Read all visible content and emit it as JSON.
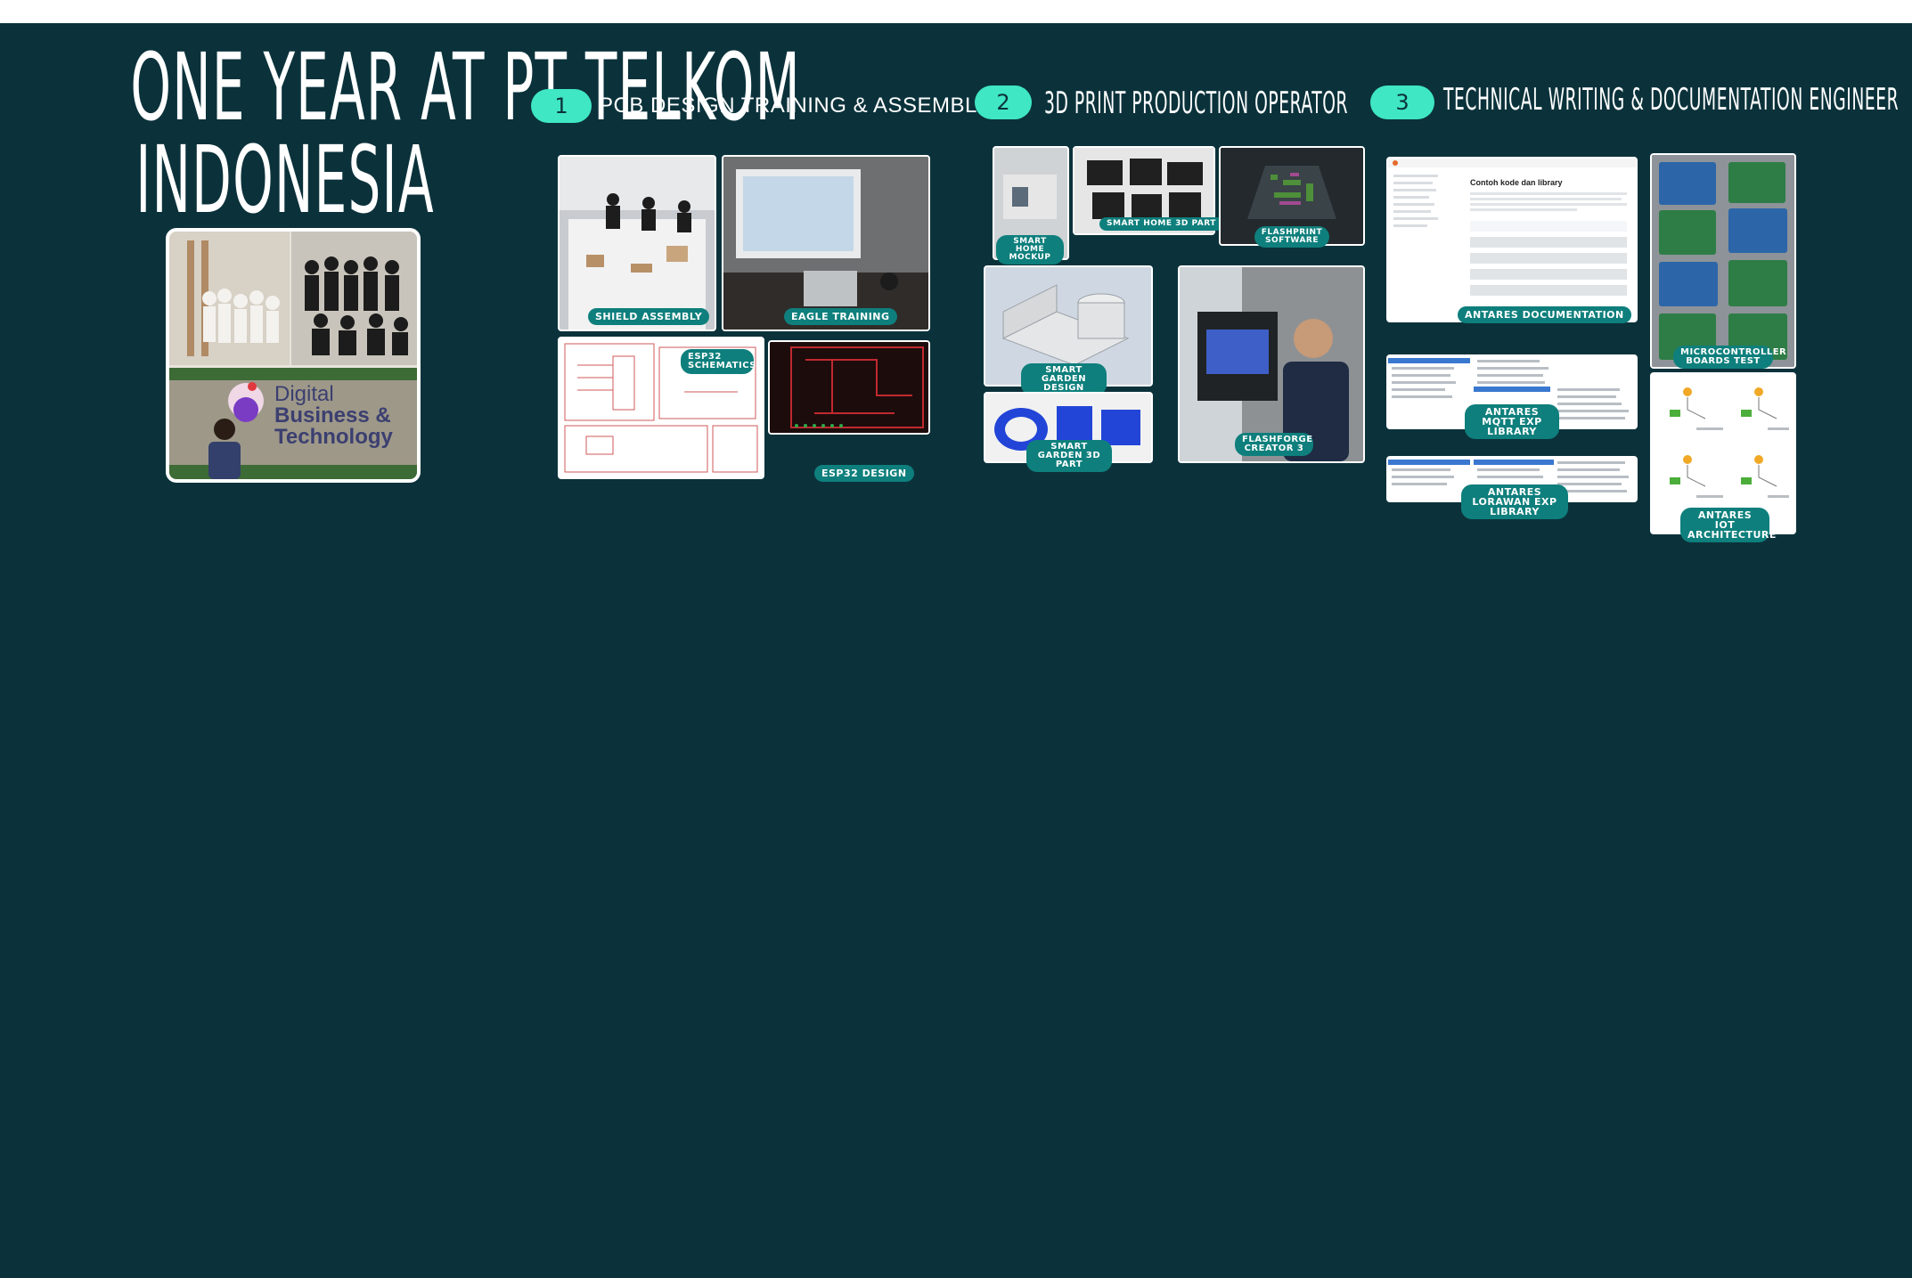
{
  "title": {
    "line1": "ONE YEAR AT PT TELKOM",
    "line2": "INDONESIA"
  },
  "intro_photo": {
    "sign_line1": "Digital",
    "sign_line2": "Business &",
    "sign_line3": "Technology"
  },
  "sections": [
    {
      "number": "1",
      "title": "PCB DESIGN TRAINING & ASSEMBLY"
    },
    {
      "number": "2",
      "title": "3D PRINT PRODUCTION OPERATOR"
    },
    {
      "number": "3",
      "title": "TECHNICAL WRITING & DOCUMENTATION ENGINEER"
    }
  ],
  "pcb": {
    "shield_assembly": "SHIELD ASSEMBLY",
    "eagle_training": "EAGLE TRAINING",
    "esp32_schematics": "ESP32 SCHEMATICS",
    "esp32_design": "ESP32 DESIGN"
  },
  "print3d": {
    "smart_home_mockup": "SMART HOME MOCKUP",
    "smart_home_3d_part": "SMART HOME 3D PART",
    "flashprint_software": "FLASHPRINT SOFTWARE",
    "smart_garden_design": "SMART GARDEN DESIGN",
    "smart_garden_3d_part": "SMART GARDEN 3D PART",
    "flashforge_creator_3": "FLASHFORGE CREATOR 3"
  },
  "docs": {
    "antares_documentation": "ANTARES DOCUMENTATION",
    "doc_heading": "Contoh kode dan library",
    "antares_mqtt": "ANTARES MQTT EXP LIBRARY",
    "antares_lorawan": "ANTARES LORAWAN EXP LIBRARY",
    "microcontroller_boards_test": "MICROCONTROLLER BOARDS TEST",
    "antares_iot_architecture": "ANTARES IOT ARCHITECTURE"
  },
  "colors": {
    "background": "#0b323b",
    "accent": "#3fe7c4",
    "label_bg": "#0e7f7c"
  }
}
